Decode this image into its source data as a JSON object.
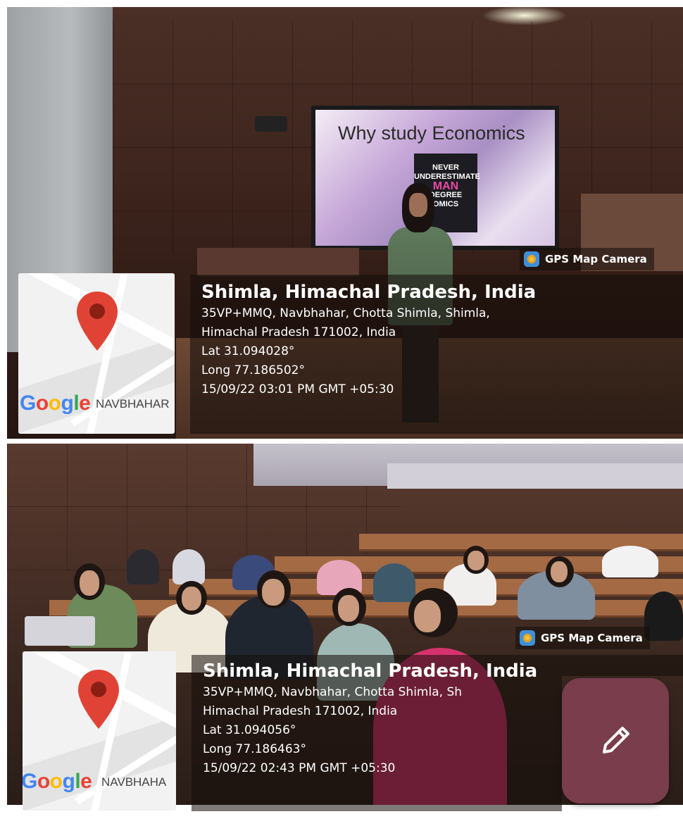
{
  "photos": [
    {
      "slide_title": "Why study Economics",
      "book_lines": [
        "NEVER",
        "UNDERESTIMATE",
        "MAN",
        "DEGREE",
        "OMICS"
      ],
      "badge": "GPS Map Camera",
      "map_label": "NAVBHAHAR",
      "location_title": "Shimla, Himachal Pradesh, India",
      "address_line1": "35VP+MMQ, Navbhahar, Chotta Shimla, Shimla,",
      "address_line2": "Himachal Pradesh 171002, India",
      "lat": "Lat 31.094028°",
      "long": "Long 77.186502°",
      "timestamp": "15/09/22 03:01 PM GMT +05:30"
    },
    {
      "badge": "GPS Map Camera",
      "map_label": "NAVBHAHA",
      "location_title": "Shimla, Himachal Pradesh, India",
      "address_line1": "35VP+MMQ, Navbhahar, Chotta Shimla, Sh",
      "address_line2": "Himachal Pradesh 171002, India",
      "lat": "Lat 31.094056°",
      "long": "Long 77.186463°",
      "timestamp": "15/09/22 02:43 PM GMT +05:30"
    }
  ],
  "google_logo": [
    "G",
    "o",
    "o",
    "g",
    "l",
    "e"
  ],
  "google_colors": [
    "#4285F4",
    "#EA4335",
    "#FBBC05",
    "#4285F4",
    "#34A853",
    "#EA4335"
  ],
  "pin_color": "#E04335",
  "fab_color": "#7A3D4C",
  "fab_icon": "pencil-icon"
}
